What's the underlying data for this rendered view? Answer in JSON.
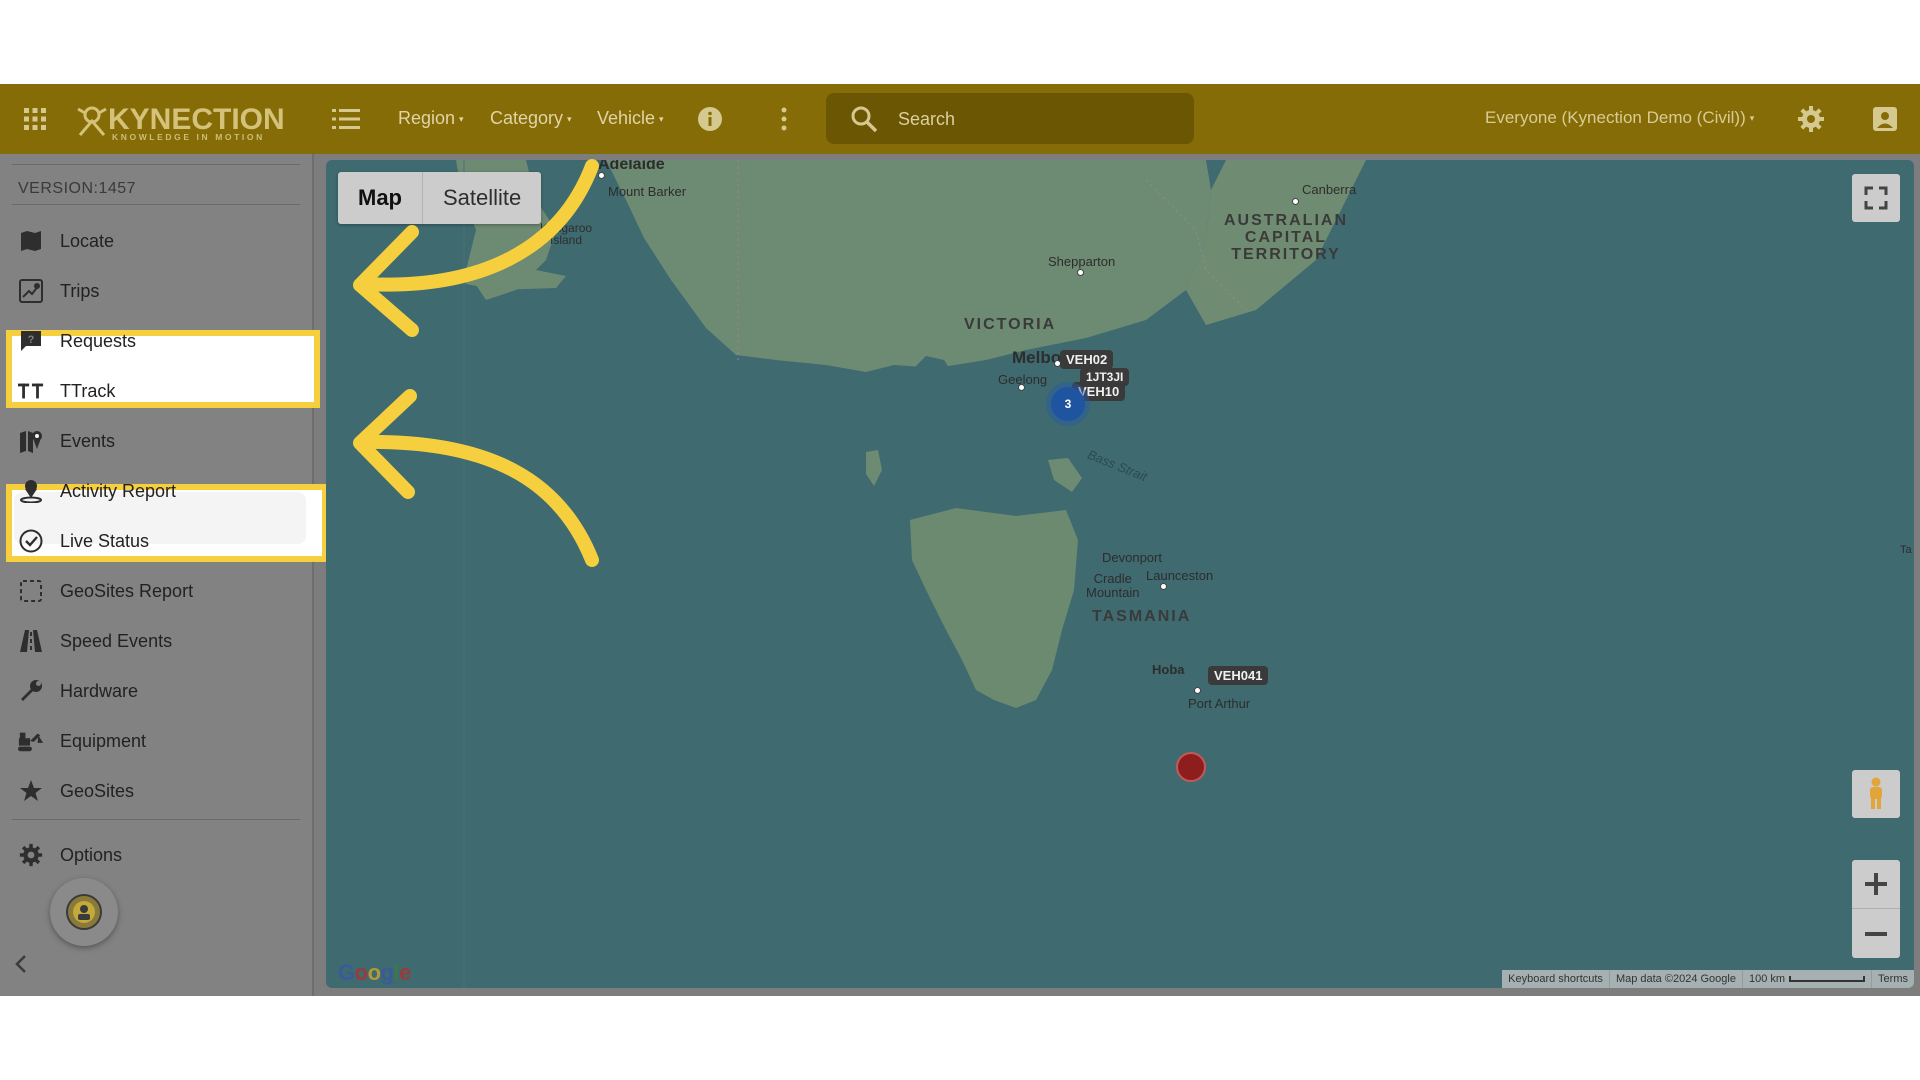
{
  "colors": {
    "topbar": "#866c06",
    "highlight": "#f6cf3e",
    "arrow": "#f6cf3e",
    "water": "#3e6a70",
    "land": "#6d8a72"
  },
  "topbar": {
    "logo_text": "KYNECTION",
    "logo_tagline": "KNOWLEDGE IN MOTION",
    "menus": [
      "Region",
      "Category",
      "Vehicle"
    ],
    "search_placeholder": "Search",
    "everyone_label": "Everyone (Kynection Demo (Civil))",
    "icons": [
      "apps-grid-icon",
      "list-icon",
      "info-icon",
      "more-vert-icon",
      "search-icon",
      "gear-icon",
      "account-icon"
    ]
  },
  "sidebar": {
    "version": "VERSION:1457",
    "items": [
      {
        "label": "Locate",
        "icon": "map-book-icon"
      },
      {
        "label": "Trips",
        "icon": "trips-icon"
      },
      {
        "label": "Requests",
        "icon": "request-chat-icon"
      },
      {
        "label": "TTrack",
        "icon": "ttrack-icon"
      },
      {
        "label": "Events",
        "icon": "map-pin-icon"
      },
      {
        "label": "Activity Report",
        "icon": "person-pin-icon"
      },
      {
        "label": "Live Status",
        "icon": "check-circle-icon"
      },
      {
        "label": "GeoSites Report",
        "icon": "dashed-square-icon"
      },
      {
        "label": "Speed Events",
        "icon": "road-icon"
      },
      {
        "label": "Hardware",
        "icon": "wrench-icon"
      },
      {
        "label": "Equipment",
        "icon": "excavator-icon"
      },
      {
        "label": "GeoSites",
        "icon": "star-icon"
      }
    ],
    "options_label": "Options",
    "highlighted": [
      "Trips",
      "Events"
    ]
  },
  "map": {
    "type_buttons": [
      "Map",
      "Satellite"
    ],
    "active_type": "Map",
    "places": {
      "adelaide": "Adelaide",
      "mount_barker": "Mount Barker",
      "kangaroo_island": "Kangaroo\nIsland",
      "canberra": "Canberra",
      "act": "AUSTRALIAN\nCAPITAL\nTERRITORY",
      "shepparton": "Shepparton",
      "victoria": "VICTORIA",
      "melbourne": "Melbo",
      "geelong": "Geelong",
      "bass_strait": "Bass Strait",
      "devonport": "Devonport",
      "launceston": "Launceston",
      "cradle_mountain": "Cradle\nMountain",
      "tasmania": "TASMANIA",
      "hobart": "Hoba",
      "port_arthur": "Port Arthur",
      "edge": "Ta"
    },
    "vehicles": [
      "VEH02",
      "1JT3JI",
      "VEH10",
      "VEH041"
    ],
    "cluster_count": "3",
    "google": "Google",
    "attribution": {
      "shortcuts": "Keyboard shortcuts",
      "data": "Map data ©2024 Google",
      "scale": "100 km",
      "terms": "Terms"
    }
  }
}
